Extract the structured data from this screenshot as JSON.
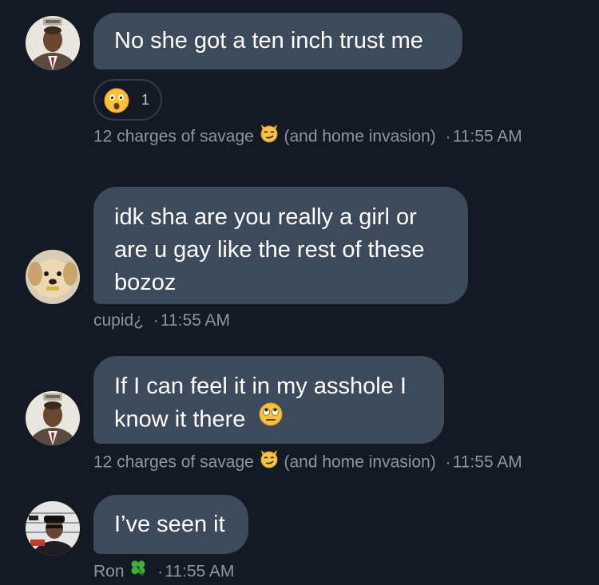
{
  "messages": [
    {
      "text_lines": [
        "No she got a ten inch trust me"
      ],
      "reaction": {
        "emoji": "astonished-face",
        "count": "1"
      },
      "sender": "12 charges of savage",
      "sender_emoji": "smirking-cat",
      "sender_suffix": "(and home invasion)",
      "time": "11:55 AM"
    },
    {
      "text_lines": [
        "idk sha are you really a girl or",
        "are u gay like the rest of these",
        "bozoz"
      ],
      "sender": "cupid¿",
      "time": "11:55 AM"
    },
    {
      "text_lines": [
        "If I can feel it in my asshole I",
        "know it there"
      ],
      "text_emoji": "face-with-rolling-eyes",
      "sender": "12 charges of savage",
      "sender_emoji": "smirking-cat",
      "sender_suffix": "(and home invasion)",
      "time": "11:55 AM"
    },
    {
      "text_lines": [
        "I’ve seen it"
      ],
      "sender": "Ron",
      "sender_emoji": "four-leaf-clover",
      "time": "11:55 AM"
    }
  ],
  "colors": {
    "background": "#141a23",
    "bubble": "#3d4a5b",
    "meta_text": "#8a96a6",
    "bubble_text": "#ffffff"
  }
}
